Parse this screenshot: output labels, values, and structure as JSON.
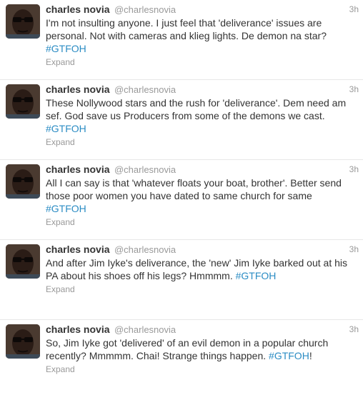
{
  "tweets": [
    {
      "fullname": "charles novia",
      "username": "@charlesnovia",
      "time": "3h",
      "text": "I'm not insulting anyone. I just feel that 'deliverance' issues are personal. Not with cameras and klieg lights. De demon na star?",
      "hashtag": "#GTFOH",
      "suffix": "",
      "expand": "Expand"
    },
    {
      "fullname": "charles novia",
      "username": "@charlesnovia",
      "time": "3h",
      "text": "These Nollywood stars and the rush for 'deliverance'. Dem need am sef. God save us Producers from some of the demons we cast. ",
      "hashtag": "#GTFOH",
      "suffix": "",
      "expand": "Expand"
    },
    {
      "fullname": "charles novia",
      "username": "@charlesnovia",
      "time": "3h",
      "text": "All I can say is that 'whatever floats your boat, brother'. Better send those poor women you have dated to same church for same ",
      "hashtag": "#GTFOH",
      "suffix": "",
      "expand": "Expand"
    },
    {
      "fullname": "charles novia",
      "username": "@charlesnovia",
      "time": "3h",
      "text": "And after Jim Iyke's deliverance, the 'new' Jim Iyke barked out at his PA about his shoes off his legs? Hmmmm. ",
      "hashtag": "#GTFOH",
      "suffix": "",
      "expand": "Expand"
    },
    {
      "fullname": "charles novia",
      "username": "@charlesnovia",
      "time": "3h",
      "text": "So, Jim Iyke got 'delivered' of an evil demon in a popular church recently? Mmmmm. Chai! Strange things happen. ",
      "hashtag": "#GTFOH",
      "suffix": "!",
      "expand": "Expand"
    }
  ]
}
